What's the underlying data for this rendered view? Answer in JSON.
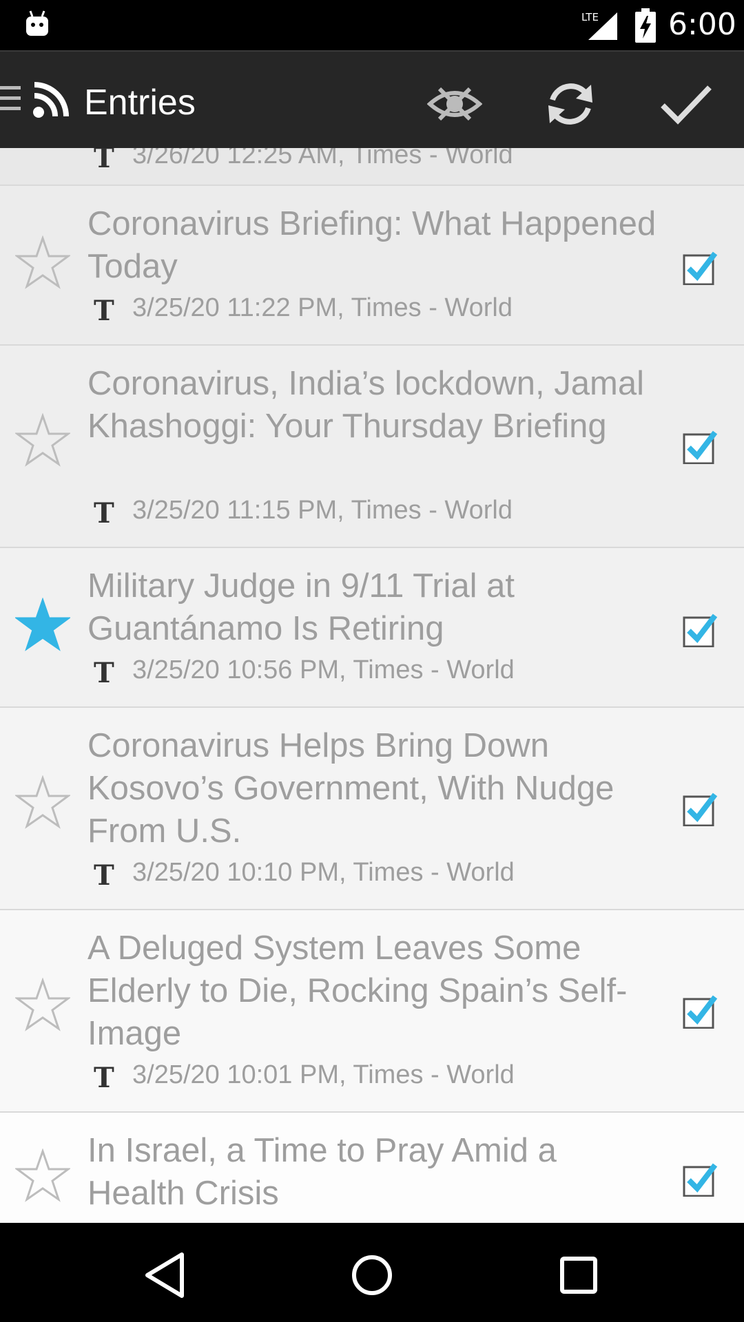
{
  "status_bar": {
    "network": "LTE",
    "time": "6:00"
  },
  "action_bar": {
    "title": "Entries",
    "icons": [
      "drawer-icon",
      "rss-icon",
      "hide-read-icon",
      "refresh-icon",
      "mark-all-read-icon"
    ]
  },
  "entries": [
    {
      "headline": "",
      "meta": "3/26/20 12:25 AM, Times - World",
      "starred": false,
      "checked": true
    },
    {
      "headline": "Coronavirus Briefing: What Happened Today",
      "meta": "3/25/20 11:22 PM, Times - World",
      "starred": false,
      "checked": true
    },
    {
      "headline": "Coronavirus, India’s lockdown, Jamal Khashoggi: Your Thursday Briefing",
      "meta": "3/25/20 11:15 PM, Times - World",
      "starred": false,
      "checked": true
    },
    {
      "headline": "Military Judge in 9/11 Trial at Guantánamo Is Retiring",
      "meta": "3/25/20 10:56 PM, Times - World",
      "starred": true,
      "checked": true
    },
    {
      "headline": "Coronavirus Helps Bring Down Kosovo’s Government, With Nudge From U.S.",
      "meta": "3/25/20 10:10 PM, Times - World",
      "starred": false,
      "checked": true
    },
    {
      "headline": "A Deluged System Leaves Some Elderly to Die, Rocking Spain’s Self-Image",
      "meta": "3/25/20 10:01 PM, Times - World",
      "starred": false,
      "checked": true
    },
    {
      "headline": "In Israel, a Time to Pray Amid a Health Crisis",
      "meta": "",
      "starred": false,
      "checked": true
    }
  ],
  "colors": {
    "accent": "#33b5e5",
    "text_read": "#9e9e9e",
    "action_bar": "#262626"
  },
  "nav_bar": {
    "icons": [
      "back-icon",
      "home-icon",
      "recents-icon"
    ]
  }
}
